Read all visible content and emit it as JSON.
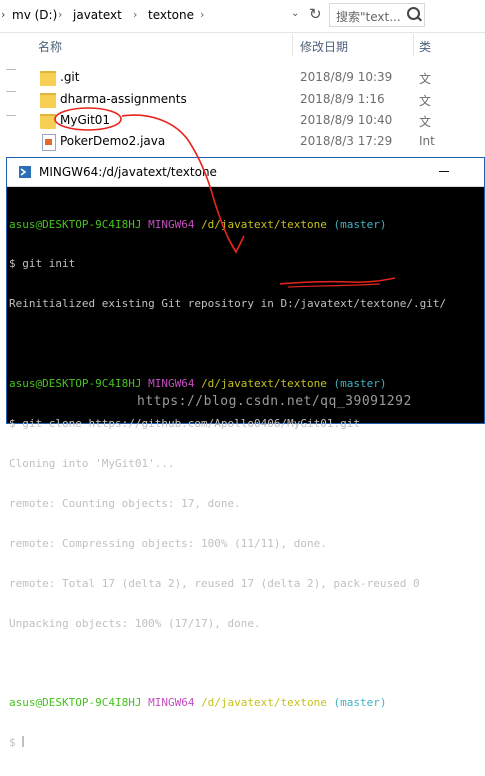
{
  "explorer": {
    "breadcrumb": [
      "mv (D:)",
      "javatext",
      "textone"
    ],
    "search_placeholder": "搜索\"text...",
    "columns": {
      "name": "名称",
      "date": "修改日期",
      "type": "类"
    },
    "rows": [
      {
        "name": ".git",
        "date": "2018/8/9 10:39",
        "type": "文"
      },
      {
        "name": "dharma-assignments",
        "date": "2018/8/9 1:16",
        "type": "文"
      },
      {
        "name": "MyGit01",
        "date": "2018/8/9 10:40",
        "type": "文"
      },
      {
        "name": "PokerDemo2.java",
        "date": "2018/8/3 17:29",
        "type": "Int"
      }
    ]
  },
  "terminal": {
    "title": "MINGW64:/d/javatext/textone",
    "prompt_user": "asus@DESKTOP-9C4I8HJ",
    "prompt_env": "MINGW64",
    "prompt_path": "/d/javatext/textone",
    "prompt_branch": "(master)",
    "cmd1": "$ git init",
    "out1": "Reinitialized existing Git repository in D:/javatext/textone/.git/",
    "cmd2": "$ git clone https://github.com/Apollo0406/MyGit01.git",
    "out2": [
      "Cloning into 'MyGit01'...",
      "remote: Counting objects: 17, done.",
      "remote: Compressing objects: 100% (11/11), done.",
      "remote: Total 17 (delta 2), reused 17 (delta 2), pack-reused 0",
      "Unpacking objects: 100% (17/17), done."
    ],
    "cmd3": "$ "
  },
  "watermark": "https://blog.csdn.net/qq_39091292",
  "colors": {
    "terminal_bg": "#000000",
    "user_green": "#46c21e",
    "env_magenta": "#c34ebe",
    "path_yellow": "#c5c21c",
    "branch_cyan": "#3fb3c3",
    "annotation_red": "#e8241c"
  }
}
